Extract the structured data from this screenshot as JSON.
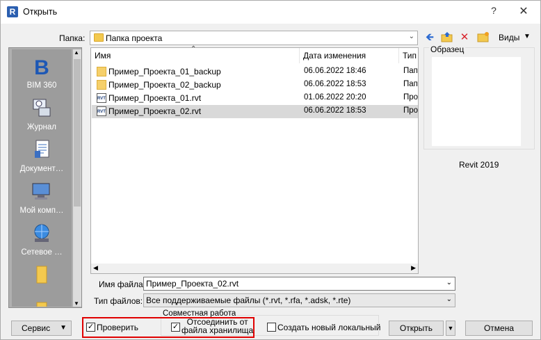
{
  "window": {
    "title": "Открыть",
    "help": "?",
    "close": "✕"
  },
  "folder": {
    "label": "Папка:",
    "current": "Папка проекта",
    "views_label": "Виды"
  },
  "places": [
    {
      "label": "BIM 360",
      "icon": "bim360-icon"
    },
    {
      "label": "Журнал",
      "icon": "history-icon"
    },
    {
      "label": "Документ…",
      "icon": "documents-icon"
    },
    {
      "label": "Мой комп…",
      "icon": "computer-icon"
    },
    {
      "label": "Сетевое …",
      "icon": "network-icon"
    },
    {
      "label": "",
      "icon": "folder-icon"
    },
    {
      "label": "",
      "icon": "folder-icon"
    }
  ],
  "file_list": {
    "columns": [
      "Имя",
      "Дата изменения",
      "Тип"
    ],
    "rows": [
      {
        "name": "Пример_Проекта_01_backup",
        "date": "06.06.2022 18:46",
        "type": "Пап",
        "kind": "folder"
      },
      {
        "name": "Пример_Проекта_02_backup",
        "date": "06.06.2022 18:53",
        "type": "Пап",
        "kind": "folder"
      },
      {
        "name": "Пример_Проекта_01.rvt",
        "date": "01.06.2022 20:20",
        "type": "Про",
        "kind": "rvt"
      },
      {
        "name": "Пример_Проекта_02.rvt",
        "date": "06.06.2022 18:53",
        "type": "Про",
        "kind": "rvt",
        "selected": true
      }
    ]
  },
  "preview": {
    "label": "Образец",
    "version": "Revit 2019"
  },
  "file_name": {
    "label": "Имя файла:",
    "value": "Пример_Проекта_02.rvt"
  },
  "file_type": {
    "label": "Тип файлов:",
    "value": "Все поддерживаемые файлы  (*.rvt, *.rfa, *.adsk, *.rte)"
  },
  "bottom": {
    "service_label": "Сервис",
    "collab_group_label": "Совместная работа",
    "verify_label": "Проверить",
    "verify_checked": true,
    "detach_label_1": "Отсоединить от",
    "detach_label_2": "файла хранилища",
    "detach_checked": true,
    "create_local_label": "Создать новый локальный",
    "create_local_checked": false,
    "open_label": "Открыть",
    "cancel_label": "Отмена"
  },
  "colors": {
    "highlight_border": "#e00000",
    "selected_row": "#d9d9d9"
  }
}
